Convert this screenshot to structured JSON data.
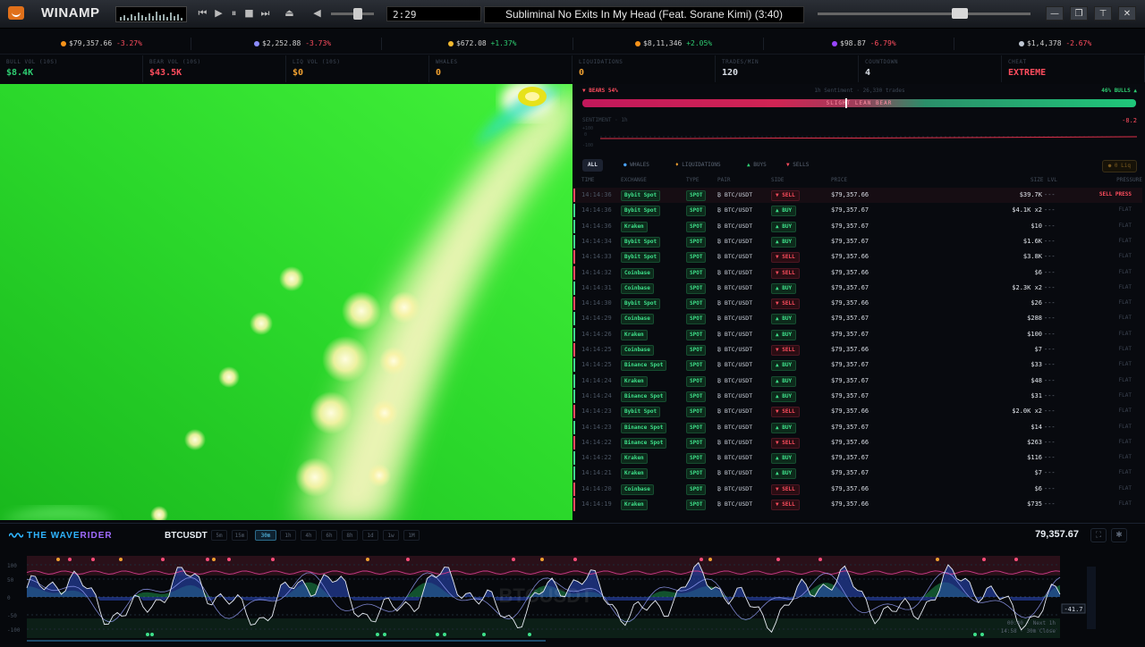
{
  "winamp": {
    "title": "WINAMP",
    "time": "2:29",
    "track": "Subliminal No Exits In My Head (Feat. Sorane Kimi) (3:40)",
    "accent": "#e0701a"
  },
  "tickers": [
    {
      "icon": "bitcoin-icon",
      "color": "#f7931a",
      "price": "$79,357.66",
      "change": "-3.27%",
      "dir": "dn"
    },
    {
      "icon": "ethereum-icon",
      "color": "#8c8cff",
      "price": "$2,252.88",
      "change": "-3.73%",
      "dir": "dn"
    },
    {
      "icon": "bnb-icon",
      "color": "#f3ba2f",
      "price": "$672.08",
      "change": "+1.37%",
      "dir": "up"
    },
    {
      "icon": "bitcoin-icon",
      "color": "#f7931a",
      "price": "$8,11,346",
      "change": "+2.05%",
      "dir": "up"
    },
    {
      "icon": "solana-icon",
      "color": "#9945ff",
      "price": "$98.87",
      "change": "-6.79%",
      "dir": "dn"
    },
    {
      "icon": "xrp-icon",
      "color": "#c0c8d4",
      "price": "$1,4,378",
      "change": "-2.67%",
      "dir": "dn"
    }
  ],
  "stats": [
    {
      "label": "BULL VOL (10S)",
      "value": "$8.4K",
      "color": "#2ecc71"
    },
    {
      "label": "BEAR VOL (10S)",
      "value": "$43.5K",
      "color": "#ff4d5e"
    },
    {
      "label": "LIQ VOL (10S)",
      "value": "$0",
      "color": "#f0a030"
    },
    {
      "label": "WHALES",
      "value": "0",
      "color": "#f0a030"
    },
    {
      "label": "LIQUIDATIONS",
      "value": "0",
      "color": "#f0a030"
    },
    {
      "label": "TRADES/MIN",
      "value": "120",
      "color": "#d8dde5"
    },
    {
      "label": "COUNTDOWN",
      "value": "4",
      "color": "#d8dde5"
    },
    {
      "label": "CHEAT",
      "value": "EXTREME",
      "color": "#ff4d5e"
    }
  ],
  "sentiment": {
    "bears": "▼ BEARS 54%",
    "center": "1h Sentiment · 26,330 trades",
    "bulls": "46% BULLS ▲",
    "bar_text": "SLIGHT LEAN BEAR",
    "bear_share": 0.54,
    "mini_label": "SENTIMENT · 1h",
    "mini_value": "-8.2",
    "ticks": [
      "+100",
      "0",
      "-100"
    ]
  },
  "filters": {
    "all": "ALL",
    "whales": "WHALES",
    "liquidations": "LIQUIDATIONS",
    "buys": "BUYS",
    "sells": "SELLS",
    "badge": "● 0 Liq"
  },
  "trade_head": {
    "time": "TIME",
    "exchange": "EXCHANGE",
    "type": "TYPE",
    "pair": "PAIR",
    "side": "SIDE",
    "price": "PRICE",
    "size": "SIZE",
    "lvl": "LVL",
    "pressure": "PRESSURE"
  },
  "trades": [
    {
      "time": "14:14:36",
      "exchange": "Bybit Spot",
      "type": "SPOT",
      "pair": "₿ BTC/USDT",
      "side": "SELL",
      "price": "$79,357.66",
      "size": "$39.7K",
      "lvl": "---",
      "pressure": "SELL PRESS"
    },
    {
      "time": "14:14:36",
      "exchange": "Bybit Spot",
      "type": "SPOT",
      "pair": "₿ BTC/USDT",
      "side": "BUY",
      "price": "$79,357.67",
      "size": "$4.1K x2",
      "lvl": "---",
      "pressure": "FLAT"
    },
    {
      "time": "14:14:36",
      "exchange": "Kraken",
      "type": "SPOT",
      "pair": "₿ BTC/USDT",
      "side": "BUY",
      "price": "$79,357.67",
      "size": "$10",
      "lvl": "---",
      "pressure": "FLAT"
    },
    {
      "time": "14:14:34",
      "exchange": "Bybit Spot",
      "type": "SPOT",
      "pair": "₿ BTC/USDT",
      "side": "BUY",
      "price": "$79,357.67",
      "size": "$1.6K",
      "lvl": "---",
      "pressure": "FLAT"
    },
    {
      "time": "14:14:33",
      "exchange": "Bybit Spot",
      "type": "SPOT",
      "pair": "₿ BTC/USDT",
      "side": "SELL",
      "price": "$79,357.66",
      "size": "$3.8K",
      "lvl": "---",
      "pressure": "FLAT"
    },
    {
      "time": "14:14:32",
      "exchange": "Coinbase",
      "type": "SPOT",
      "pair": "₿ BTC/USDT",
      "side": "SELL",
      "price": "$79,357.66",
      "size": "$6",
      "lvl": "---",
      "pressure": "FLAT"
    },
    {
      "time": "14:14:31",
      "exchange": "Coinbase",
      "type": "SPOT",
      "pair": "₿ BTC/USDT",
      "side": "BUY",
      "price": "$79,357.67",
      "size": "$2.3K x2",
      "lvl": "---",
      "pressure": "FLAT"
    },
    {
      "time": "14:14:30",
      "exchange": "Bybit Spot",
      "type": "SPOT",
      "pair": "₿ BTC/USDT",
      "side": "SELL",
      "price": "$79,357.66",
      "size": "$26",
      "lvl": "---",
      "pressure": "FLAT"
    },
    {
      "time": "14:14:29",
      "exchange": "Coinbase",
      "type": "SPOT",
      "pair": "₿ BTC/USDT",
      "side": "BUY",
      "price": "$79,357.67",
      "size": "$288",
      "lvl": "---",
      "pressure": "FLAT"
    },
    {
      "time": "14:14:26",
      "exchange": "Kraken",
      "type": "SPOT",
      "pair": "₿ BTC/USDT",
      "side": "BUY",
      "price": "$79,357.67",
      "size": "$100",
      "lvl": "---",
      "pressure": "FLAT"
    },
    {
      "time": "14:14:25",
      "exchange": "Coinbase",
      "type": "SPOT",
      "pair": "₿ BTC/USDT",
      "side": "SELL",
      "price": "$79,357.66",
      "size": "$7",
      "lvl": "---",
      "pressure": "FLAT"
    },
    {
      "time": "14:14:25",
      "exchange": "Binance Spot",
      "type": "SPOT",
      "pair": "₿ BTC/USDT",
      "side": "BUY",
      "price": "$79,357.67",
      "size": "$33",
      "lvl": "---",
      "pressure": "FLAT"
    },
    {
      "time": "14:14:24",
      "exchange": "Kraken",
      "type": "SPOT",
      "pair": "₿ BTC/USDT",
      "side": "BUY",
      "price": "$79,357.67",
      "size": "$48",
      "lvl": "---",
      "pressure": "FLAT"
    },
    {
      "time": "14:14:24",
      "exchange": "Binance Spot",
      "type": "SPOT",
      "pair": "₿ BTC/USDT",
      "side": "BUY",
      "price": "$79,357.67",
      "size": "$31",
      "lvl": "---",
      "pressure": "FLAT"
    },
    {
      "time": "14:14:23",
      "exchange": "Bybit Spot",
      "type": "SPOT",
      "pair": "₿ BTC/USDT",
      "side": "SELL",
      "price": "$79,357.66",
      "size": "$2.0K x2",
      "lvl": "---",
      "pressure": "FLAT"
    },
    {
      "time": "14:14:23",
      "exchange": "Binance Spot",
      "type": "SPOT",
      "pair": "₿ BTC/USDT",
      "side": "BUY",
      "price": "$79,357.67",
      "size": "$14",
      "lvl": "---",
      "pressure": "FLAT"
    },
    {
      "time": "14:14:22",
      "exchange": "Binance Spot",
      "type": "SPOT",
      "pair": "₿ BTC/USDT",
      "side": "SELL",
      "price": "$79,357.66",
      "size": "$263",
      "lvl": "---",
      "pressure": "FLAT"
    },
    {
      "time": "14:14:22",
      "exchange": "Kraken",
      "type": "SPOT",
      "pair": "₿ BTC/USDT",
      "side": "BUY",
      "price": "$79,357.67",
      "size": "$116",
      "lvl": "---",
      "pressure": "FLAT"
    },
    {
      "time": "14:14:21",
      "exchange": "Kraken",
      "type": "SPOT",
      "pair": "₿ BTC/USDT",
      "side": "BUY",
      "price": "$79,357.67",
      "size": "$7",
      "lvl": "---",
      "pressure": "FLAT"
    },
    {
      "time": "14:14:20",
      "exchange": "Coinbase",
      "type": "SPOT",
      "pair": "₿ BTC/USDT",
      "side": "SELL",
      "price": "$79,357.66",
      "size": "$6",
      "lvl": "---",
      "pressure": "FLAT"
    },
    {
      "time": "14:14:19",
      "exchange": "Kraken",
      "type": "SPOT",
      "pair": "₿ BTC/USDT",
      "side": "SELL",
      "price": "$79,357.66",
      "size": "$735",
      "lvl": "---",
      "pressure": "FLAT"
    }
  ],
  "colors": {
    "buy": "#3ee08a",
    "sell": "#ff4d5e",
    "accent": "#2fb4ff"
  },
  "waverider": {
    "logo_a": "THE WAVE",
    "logo_b": "RIDER",
    "symbol": "BTCUSDT",
    "timeframes": [
      "5m",
      "15m",
      "30m",
      "1h",
      "4h",
      "6h",
      "8h",
      "1d",
      "1w",
      "1M"
    ],
    "active_timeframe": "30m",
    "price": "79,357.67",
    "axis": [
      "100",
      "50",
      "0",
      "-50",
      "-100"
    ],
    "watermark": "BTCUSDT",
    "value_tag": "-41.7",
    "footer_a": "00:40 · Next 1h",
    "footer_b": "14:58 · 30m Close"
  }
}
